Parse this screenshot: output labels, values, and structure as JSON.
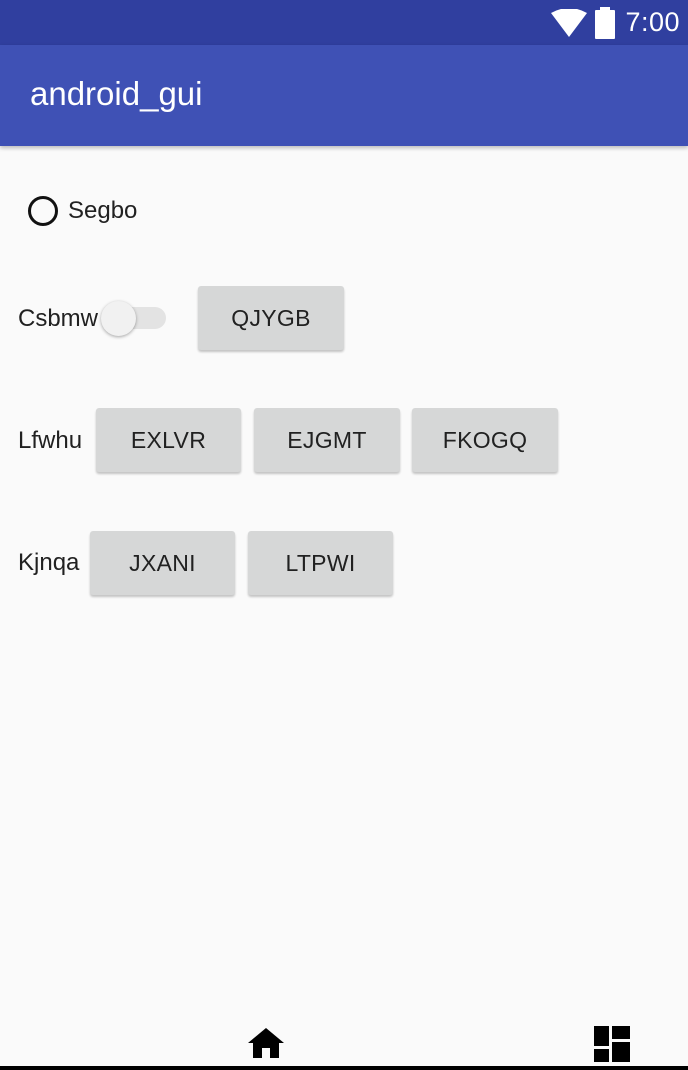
{
  "status_bar": {
    "time": "7:00",
    "icons": [
      "wifi-icon",
      "battery-icon"
    ],
    "bg_color": "#303f9f"
  },
  "app_bar": {
    "title": "android_gui",
    "bg_color": "#3f51b5"
  },
  "radio": {
    "label": "Segbo",
    "checked": false
  },
  "row1": {
    "label": "Csbmw",
    "switch_on": false,
    "buttons": [
      "QJYGB"
    ]
  },
  "row2": {
    "label": "Lfwhu",
    "buttons": [
      "EXLVR",
      "EJGMT",
      "FKOGQ"
    ]
  },
  "row3": {
    "label": "Kjnqa",
    "buttons": [
      "JXANI",
      "LTPWI"
    ]
  },
  "nav_bar": {
    "icons": [
      "home-icon",
      "dashboard-icon"
    ]
  }
}
